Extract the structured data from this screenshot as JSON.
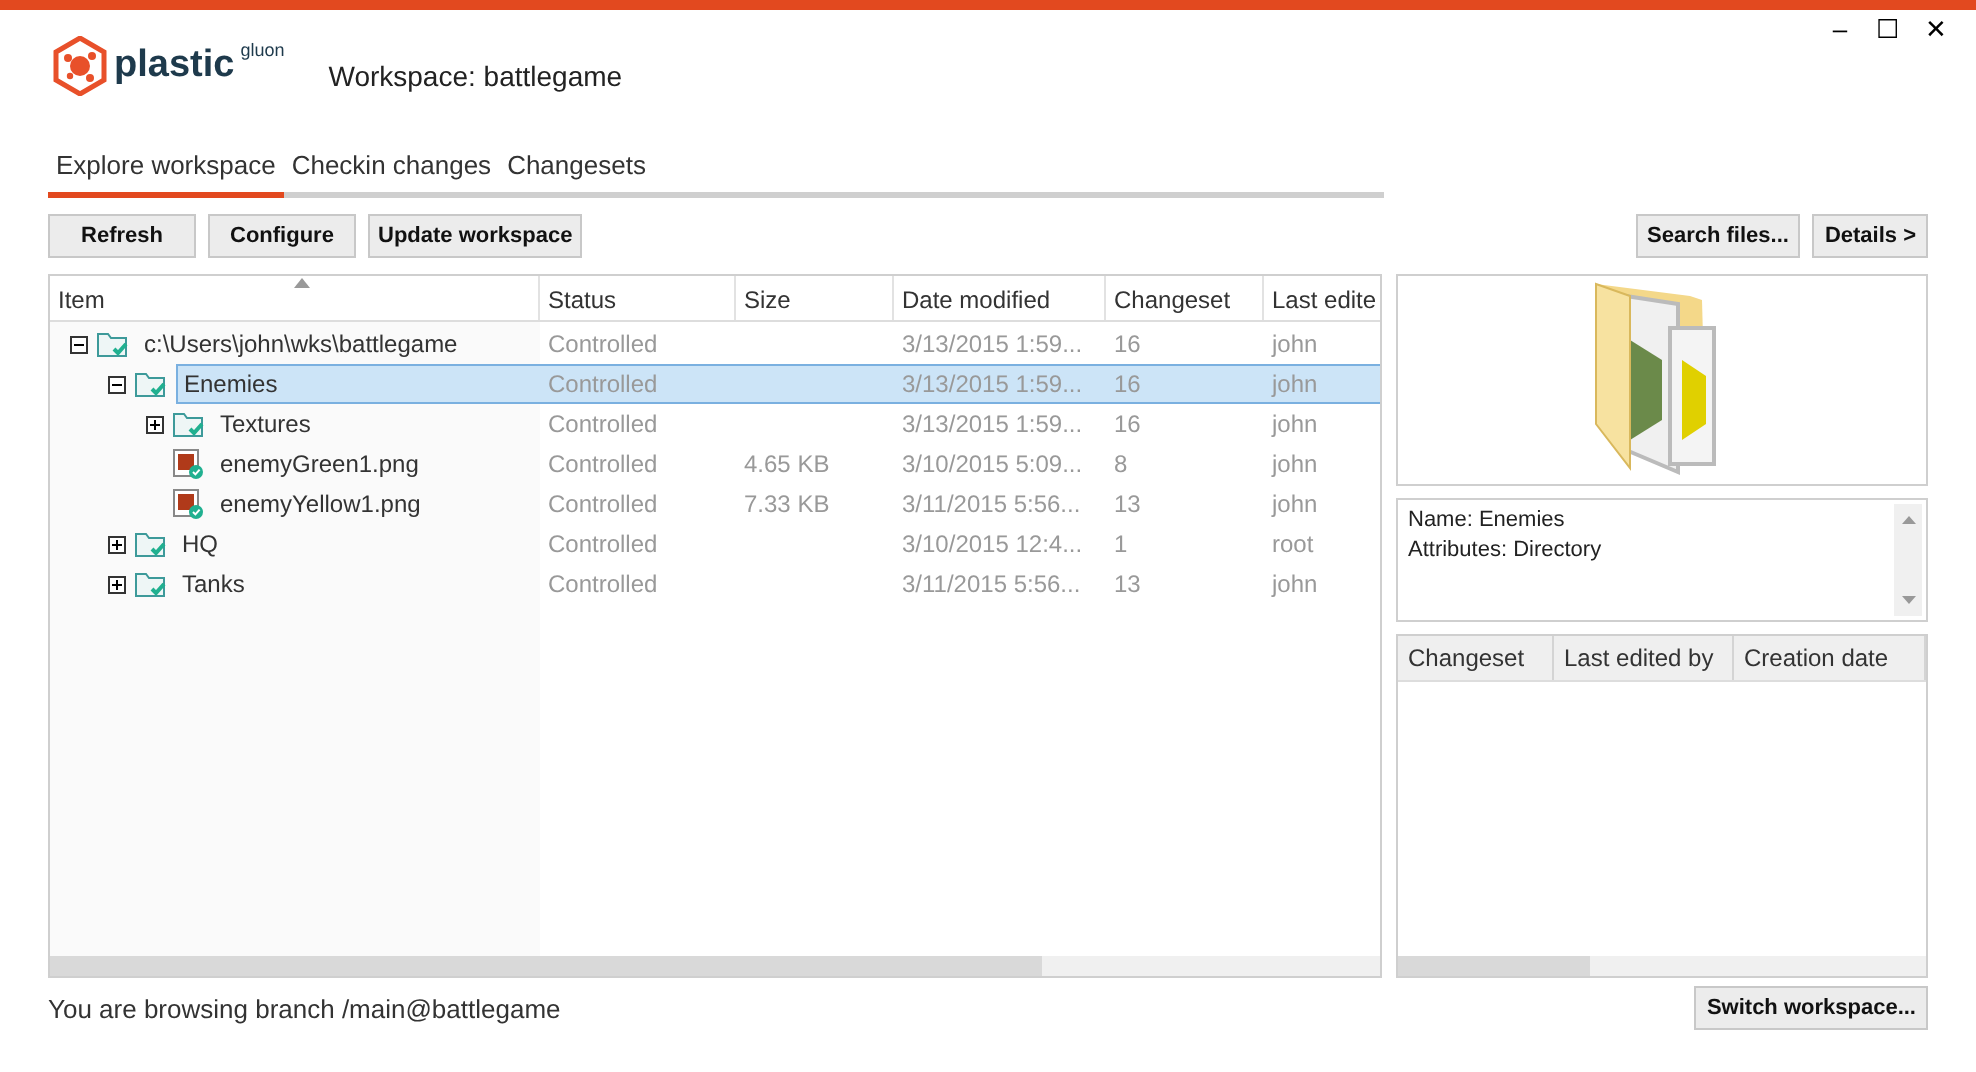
{
  "window": {
    "app_name": "plastic",
    "app_suffix": "gluon",
    "title": "Workspace: battlegame",
    "controls": [
      "–",
      "☐",
      "✕"
    ]
  },
  "tabs": [
    {
      "label": "Explore workspace",
      "selected": true
    },
    {
      "label": "Checkin changes",
      "selected": false
    },
    {
      "label": "Changesets",
      "selected": false
    }
  ],
  "toolbar": {
    "left": [
      "Refresh",
      "Configure",
      "Update workspace"
    ],
    "right": [
      "Search files...",
      "Details >"
    ]
  },
  "table": {
    "columns": [
      "Item",
      "Status",
      "Size",
      "Date modified",
      "Changeset",
      "Last edite"
    ],
    "rows": [
      {
        "kind": "folder",
        "name": "c:\\Users\\john\\wks\\battlegame",
        "status": "Controlled",
        "date": "3/13/2015 1:59...",
        "changeset": "16",
        "editor": "john",
        "expanded": true,
        "selected": false,
        "children": [
          {
            "kind": "folder",
            "name": "Enemies",
            "status": "Controlled",
            "date": "3/13/2015 1:59...",
            "changeset": "16",
            "editor": "john",
            "expanded": true,
            "selected": true,
            "children": [
              {
                "kind": "folder",
                "name": "Textures",
                "status": "Controlled",
                "date": "3/13/2015 1:59...",
                "changeset": "16",
                "editor": "john",
                "expanded": false,
                "selected": false
              },
              {
                "kind": "file",
                "name": "enemyGreen1.png",
                "status": "Controlled",
                "size": "4.65 KB",
                "date": "3/10/2015 5:09...",
                "changeset": "8",
                "editor": "john",
                "selected": false
              },
              {
                "kind": "file",
                "name": "enemyYellow1.png",
                "status": "Controlled",
                "size": "7.33 KB",
                "date": "3/11/2015 5:56...",
                "changeset": "13",
                "editor": "john",
                "selected": false
              }
            ]
          },
          {
            "kind": "folder",
            "name": "HQ",
            "status": "Controlled",
            "date": "3/10/2015 12:4...",
            "changeset": "1",
            "editor": "root",
            "expanded": false,
            "selected": false
          },
          {
            "kind": "folder",
            "name": "Tanks",
            "status": "Controlled",
            "date": "3/11/2015 5:56...",
            "changeset": "13",
            "editor": "john",
            "expanded": false,
            "selected": false
          }
        ]
      }
    ]
  },
  "details": {
    "lines": [
      "Name: Enemies",
      "Attributes: Directory"
    ]
  },
  "history": {
    "columns": [
      "Changeset",
      "Last edited by",
      "Creation date"
    ]
  },
  "status_bar": {
    "text": "You are browsing branch /main@battlegame",
    "button": "Switch workspace..."
  }
}
